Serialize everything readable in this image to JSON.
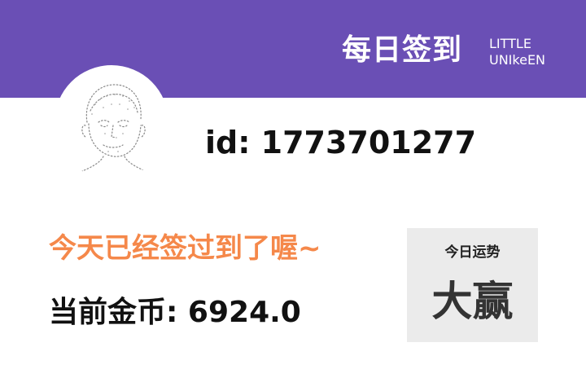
{
  "header": {
    "title": "每日签到",
    "brand_line1": "LITTLE",
    "brand_line2": "UNIkeEN",
    "color": "#6a4fb5"
  },
  "user": {
    "id_text": "id: 1773701277",
    "avatar": "sketch-portrait"
  },
  "checkin": {
    "status_text": "今天已经签过到了喔~",
    "status_color": "#f5884a",
    "coins_text": "当前金币: 6924.0"
  },
  "fortune": {
    "label": "今日运势",
    "value": "大赢"
  }
}
